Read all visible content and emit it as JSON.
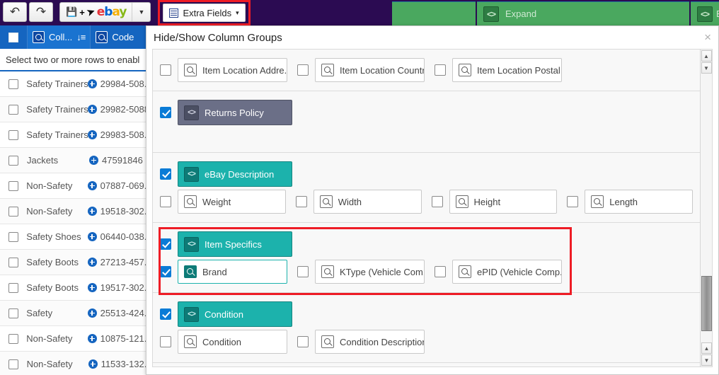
{
  "toolbar": {
    "undo_label": "↶",
    "redo_label": "↷",
    "save_label": "💾",
    "plus_label": "+",
    "send_label": "➤",
    "ebay_e": "e",
    "ebay_b": "b",
    "ebay_a": "a",
    "ebay_y": "y",
    "dropdown_caret": "▼",
    "extra_fields_label": "Extra Fields",
    "extra_fields_caret": "▾",
    "extra_fields_icon": "grid-icon",
    "highlight_color": "#ee1c25",
    "expand_label": "Expand",
    "expand_icon_glyph": "<>",
    "expand2_label": "E",
    "purple_bg": "#2b0b52",
    "green_bg": "#4aa85f"
  },
  "grid": {
    "header": {
      "select_all": "",
      "col_collection": "Coll...",
      "col_code": "Code",
      "sort_icon": "↓≡"
    },
    "notice": "Select two or more rows to enabl",
    "rows": [
      {
        "category": "Safety Trainers",
        "code": "29984-508.."
      },
      {
        "category": "Safety Trainers",
        "code": "29982-5088"
      },
      {
        "category": "Safety Trainers",
        "code": "29983-508.."
      },
      {
        "category": "Jackets",
        "code": "47591846"
      },
      {
        "category": "Non-Safety",
        "code": "07887-069.."
      },
      {
        "category": "Non-Safety",
        "code": "19518-302.."
      },
      {
        "category": "Safety Shoes",
        "code": "06440-038.."
      },
      {
        "category": "Safety Boots",
        "code": "27213-457.."
      },
      {
        "category": "Safety Boots",
        "code": "19517-302.."
      },
      {
        "category": "Safety",
        "code": "25513-424.."
      },
      {
        "category": "Non-Safety",
        "code": "10875-121.."
      },
      {
        "category": "Non-Safety",
        "code": "11533-132.."
      }
    ]
  },
  "modal": {
    "title": "Hide/Show Column Groups",
    "close_label": "×",
    "sections": [
      {
        "id": "item-location",
        "type": "fields",
        "fields": [
          {
            "label": "Item Location Addre...",
            "checked": false,
            "selected": false
          },
          {
            "label": "Item Location Country",
            "checked": false,
            "selected": false
          },
          {
            "label": "Item Location Postal...",
            "checked": false,
            "selected": false
          }
        ]
      },
      {
        "id": "returns-policy",
        "type": "group",
        "group": {
          "label": "Returns Policy",
          "checked": true,
          "color": "gray",
          "icon": "<>"
        },
        "fields": []
      },
      {
        "id": "ebay-description",
        "type": "group",
        "group": {
          "label": "eBay Description",
          "checked": true,
          "color": "teal",
          "icon": "<>"
        },
        "fields": [
          {
            "label": "Weight",
            "checked": false,
            "selected": false
          },
          {
            "label": "Width",
            "checked": false,
            "selected": false
          },
          {
            "label": "Height",
            "checked": false,
            "selected": false
          },
          {
            "label": "Length",
            "checked": false,
            "selected": false
          }
        ]
      },
      {
        "id": "item-specifics",
        "type": "group",
        "highlighted": true,
        "group": {
          "label": "Item Specifics",
          "checked": true,
          "color": "teal",
          "icon": "<>"
        },
        "fields": [
          {
            "label": "Brand",
            "checked": true,
            "selected": true
          },
          {
            "label": "KType (Vehicle Com...",
            "checked": false,
            "selected": false
          },
          {
            "label": "ePID (Vehicle Comp...",
            "checked": false,
            "selected": false
          }
        ]
      },
      {
        "id": "condition",
        "type": "group",
        "group": {
          "label": "Condition",
          "checked": true,
          "color": "teal",
          "icon": "<>"
        },
        "fields": [
          {
            "label": "Condition",
            "checked": false,
            "selected": false
          },
          {
            "label": "Condition Description",
            "checked": false,
            "selected": false
          }
        ]
      }
    ],
    "scrollbar": {
      "up_arrow": "▲",
      "down_arrow": "▼"
    }
  }
}
